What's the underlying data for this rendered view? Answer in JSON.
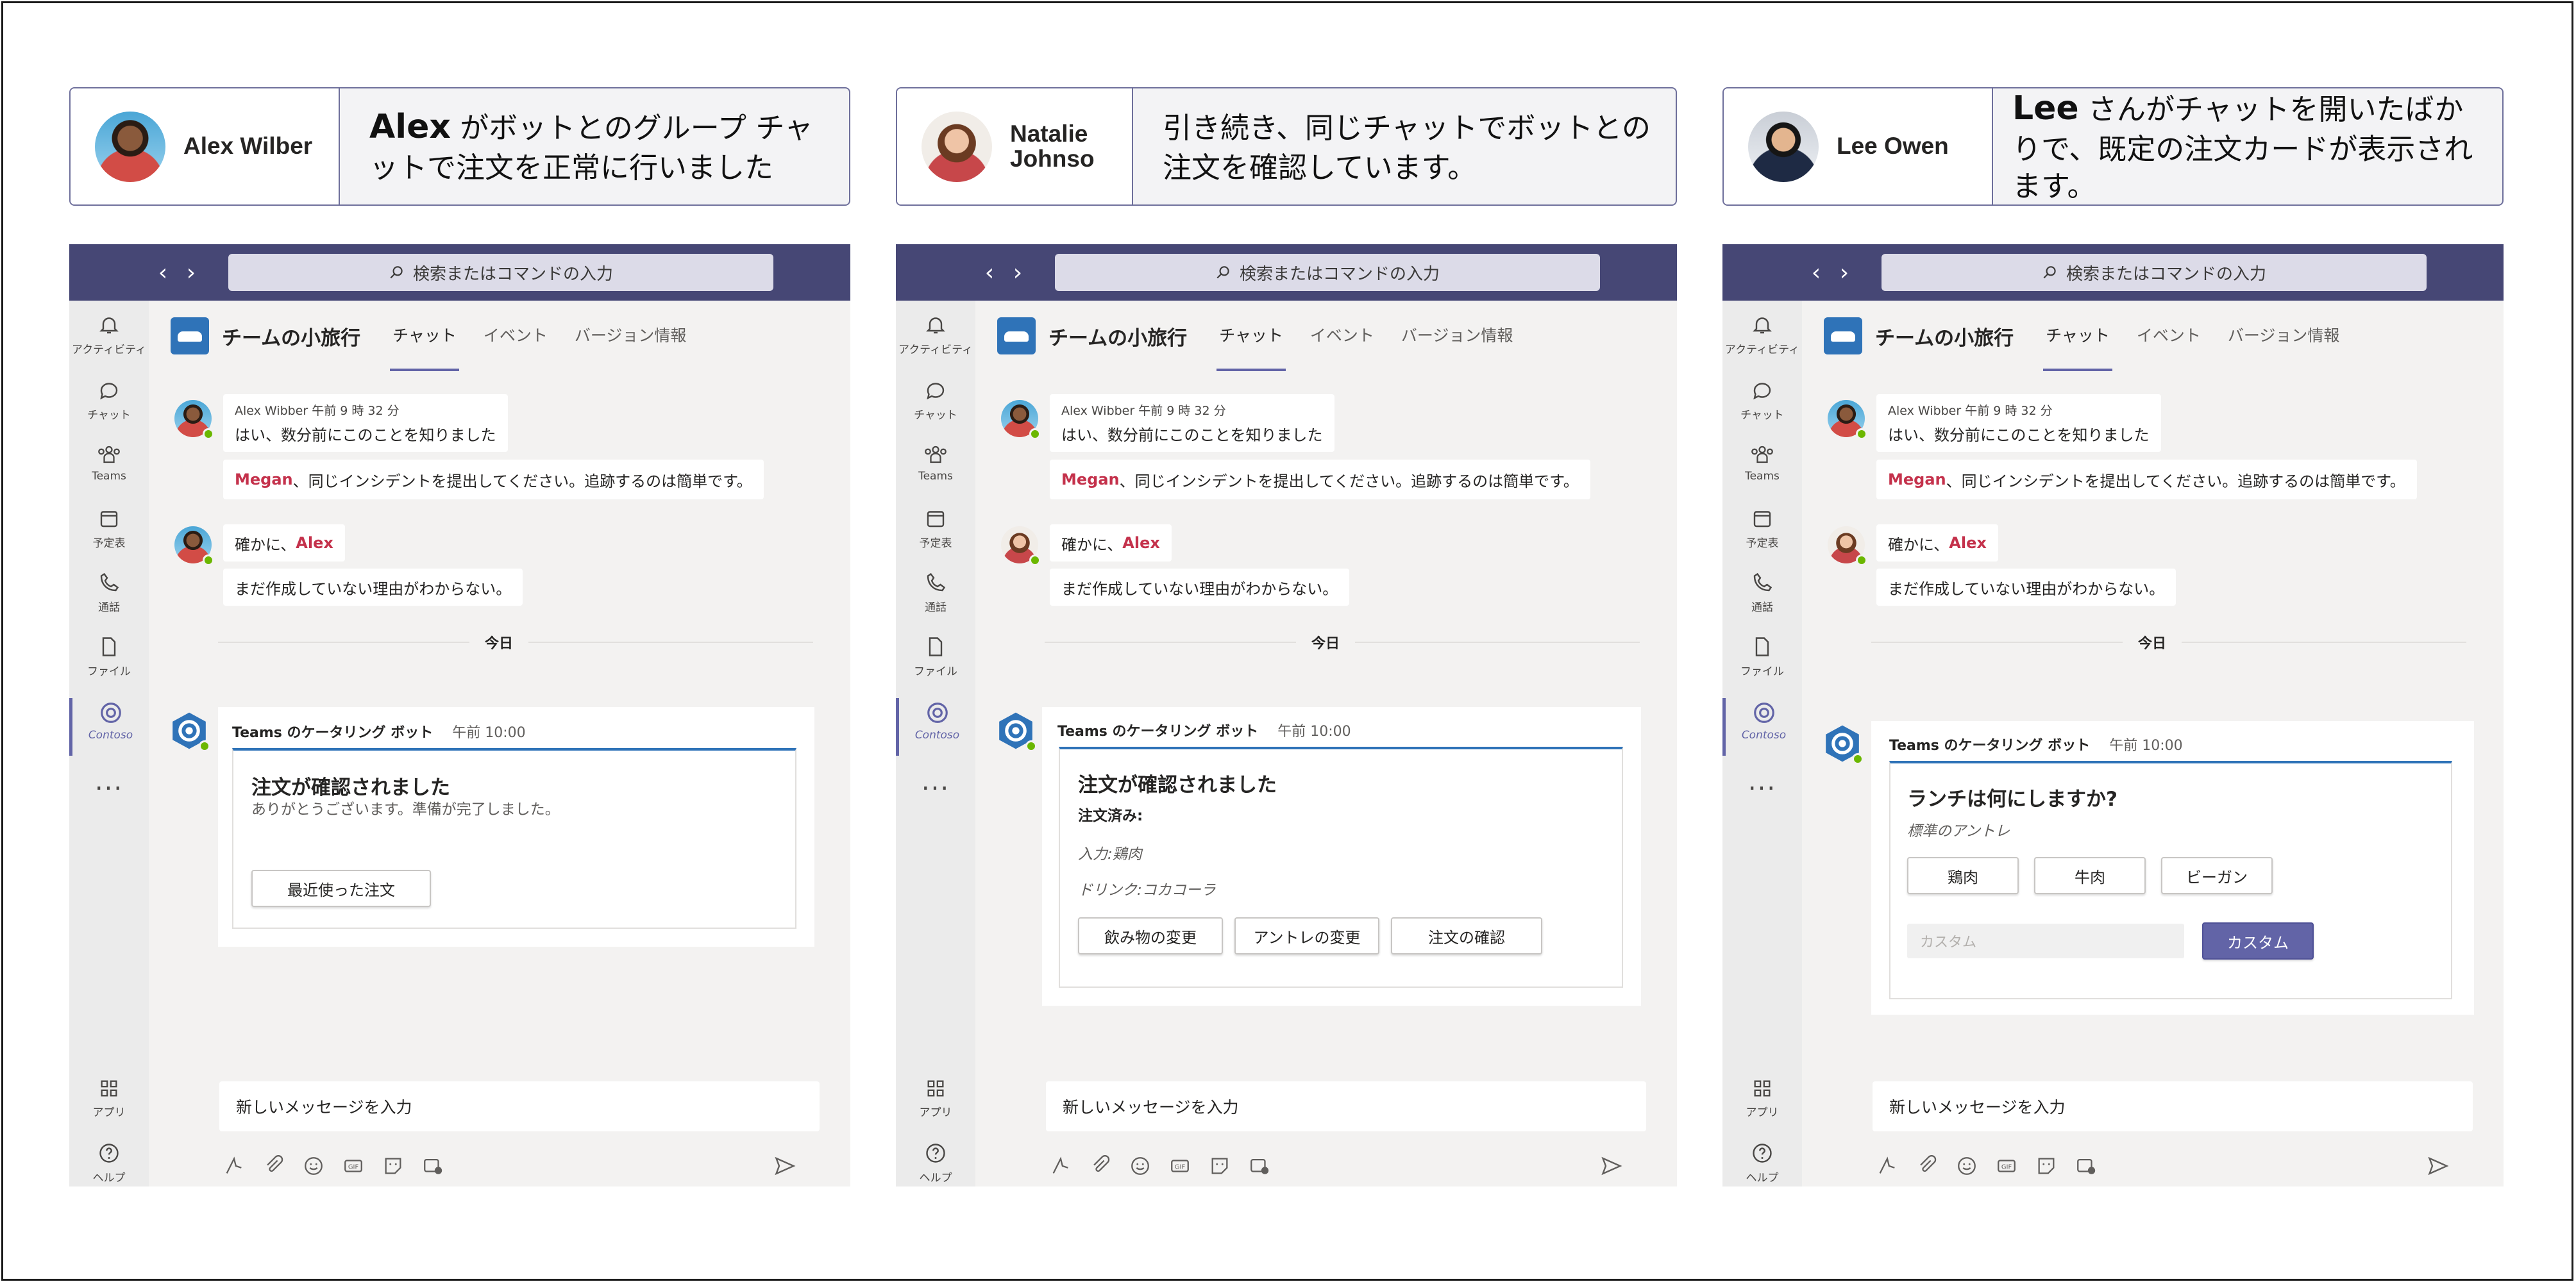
{
  "panels": [
    {
      "user_name": "Alex Wilber",
      "desc_bold": "Alex",
      "desc_rest": " がボットとのグループ チャットで注文を正常に行いました",
      "second_avatar": "alex"
    },
    {
      "user_name": "Natalie Johnso",
      "desc_bold": "",
      "desc_rest": "引き続き、同じチャットでボットとの注文を確認しています。",
      "second_avatar": "natalie"
    },
    {
      "user_name": "Lee Owen",
      "desc_bold": "Lee",
      "desc_rest": " さんがチャットを開いたばかりで、既定の注文カードが表示されます。",
      "second_avatar": "natalie"
    }
  ],
  "teams": {
    "search_placeholder": "検索またはコマンドの入力",
    "nav_back": "‹",
    "nav_forward": "›",
    "rail": {
      "activity": "アクティビティ",
      "chat": "チャット",
      "teams": "Teams",
      "calendar": "予定表",
      "calls": "通話",
      "files": "ファイル",
      "contoso": "Contoso",
      "more": "...",
      "apps": "アプリ",
      "help": "ヘルプ"
    },
    "channel_title": "チームの小旅行",
    "tabs": [
      "チャット",
      "イベント",
      "バージョン情報"
    ],
    "messages": {
      "sender_meta": "Alex Wibber  午前 9 時 32 分",
      "m1": "はい、数分前にこのことを知りました",
      "m2_mention": "Megan",
      "m2_rest": "、同じインシデントを提出してください。追跡するのは簡単です。",
      "m3_prefix": "確かに、",
      "m3_mention": "Alex",
      "m4": "まだ作成していない理由がわからない。"
    },
    "today": "今日",
    "bot_name": "Teams のケータリング ボット",
    "bot_time": "午前 10:00",
    "compose_placeholder": "新しいメッセージを入力",
    "composer_icons": [
      "format-icon",
      "attach-icon",
      "emoji-icon",
      "gif-icon",
      "sticker-icon",
      "meeting-icon",
      "send-icon"
    ]
  },
  "cards": {
    "confirmed": {
      "title": "注文が確認されました",
      "subtitle": "ありがとうございます。準備が完了しました。",
      "button": "最近使った注文"
    },
    "review": {
      "title": "注文が確認されました",
      "ordered_label": "注文済み:",
      "entree": "入力:鶏肉",
      "drink": "ドリンク:コカコーラ",
      "buttons": [
        "飲み物の変更",
        "アントレの変更",
        "注文の確認"
      ]
    },
    "lunch": {
      "title": "ランチは何にしますか?",
      "subtitle": "標準のアントレ",
      "options": [
        "鶏肉",
        "牛肉",
        "ビーガン"
      ],
      "custom_placeholder": "カスタム",
      "custom_button": "カスタム"
    }
  },
  "colors": {
    "teams_purple": "#464775",
    "accent": "#6264a7",
    "mention": "#c4314b",
    "card_accent": "#2f73b8"
  }
}
